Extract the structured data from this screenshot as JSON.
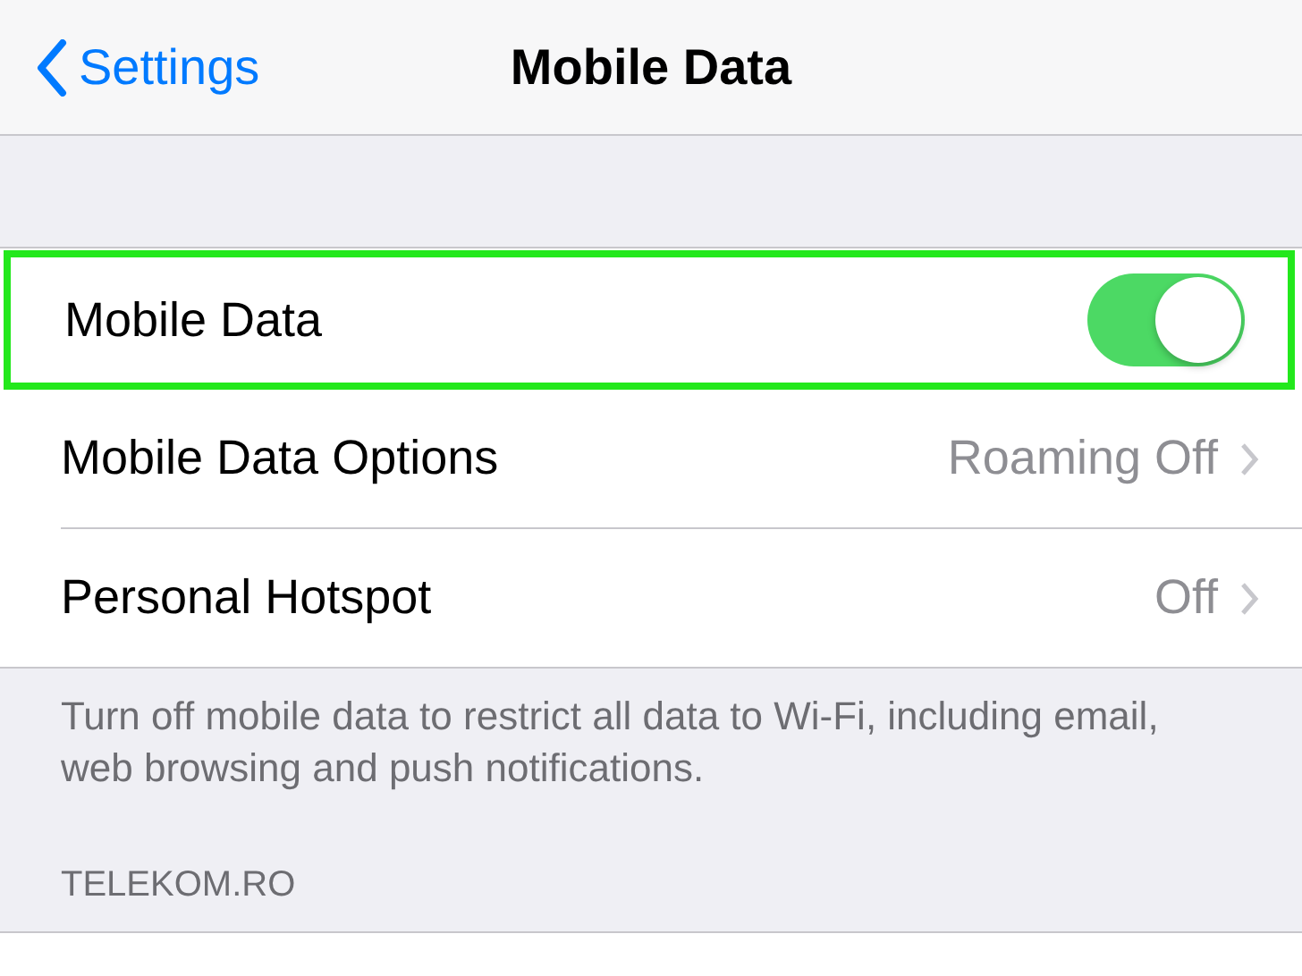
{
  "nav": {
    "back": "Settings",
    "title": "Mobile Data"
  },
  "rows": [
    {
      "kind": "toggle",
      "label": "Mobile Data",
      "on": true,
      "highlighted": true
    },
    {
      "kind": "link",
      "label": "Mobile Data Options",
      "value": "Roaming Off",
      "highlighted": false
    },
    {
      "kind": "link",
      "label": "Personal Hotspot",
      "value": "Off",
      "highlighted": false
    }
  ],
  "footer": "Turn off mobile data to restrict all data to Wi-Fi, including email, web browsing and push notifications.",
  "section_header": "TELEKOM.RO"
}
